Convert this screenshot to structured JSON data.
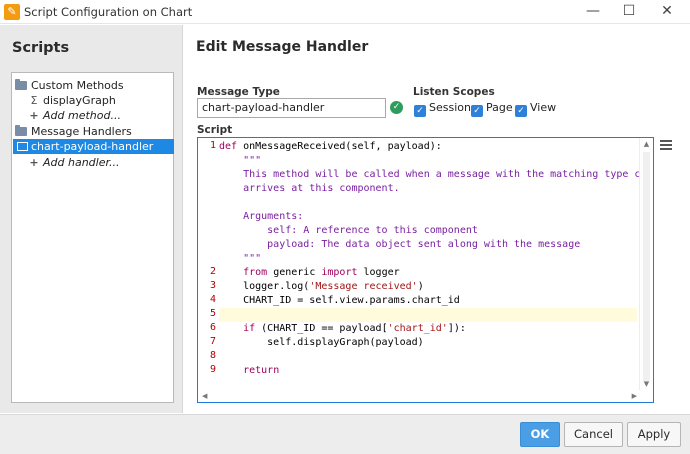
{
  "window": {
    "title": "Script Configuration on Chart",
    "app_icon_glyph": "✎",
    "minimize_glyph": "—",
    "maximize_glyph": "☐",
    "close_glyph": "✕"
  },
  "sidebar": {
    "heading": "Scripts",
    "custom_methods": {
      "label": "Custom Methods",
      "items": [
        {
          "icon": "Σ",
          "label": "displayGraph"
        }
      ],
      "add_label": "Add method..."
    },
    "message_handlers": {
      "label": "Message Handlers",
      "items": [
        {
          "label": "chart-payload-handler",
          "selected": true
        }
      ],
      "add_label": "Add handler..."
    }
  },
  "main": {
    "heading": "Edit Message Handler",
    "message_type_label": "Message Type",
    "message_type_value": "chart-payload-handler",
    "valid_glyph": "✓",
    "listen_scopes_label": "Listen Scopes",
    "scopes": [
      {
        "label": "Session",
        "checked": true
      },
      {
        "label": "Page",
        "checked": true
      },
      {
        "label": "View",
        "checked": true
      }
    ],
    "checkmark_glyph": "✓",
    "script_label": "Script"
  },
  "editor": {
    "line_numbers": [
      "1",
      "2",
      "3",
      "4",
      "5",
      "6",
      "7",
      "8",
      "9"
    ],
    "lines": {
      "l1_kw": "def",
      "l1_rest": " onMessageReceived(self, payload):",
      "d1": "    \"\"\"",
      "d2": "    This method will be called when a message with the matching type code",
      "d3": "    arrives at this component.",
      "d4": "    Arguments:",
      "d5": "        self: A reference to this component",
      "d6": "        payload: The data object sent along with the message",
      "d7": "    \"\"\"",
      "l2_kw1": "from",
      "l2_mid": " generic ",
      "l2_kw2": "import",
      "l2_rest": " logger",
      "l3_pre": "    logger.log(",
      "l3_str": "'Message received'",
      "l3_post": ")",
      "l4": "    CHART_ID = self.view.params.chart_id",
      "l6_kw": "if",
      "l6_pre": " (CHART_ID == payload[",
      "l6_str": "'chart_id'",
      "l6_post": "]):",
      "l7": "        self.displayGraph(payload)",
      "l9_kw": "return"
    }
  },
  "footer": {
    "ok_label": "OK",
    "cancel_label": "Cancel",
    "apply_label": "Apply"
  }
}
